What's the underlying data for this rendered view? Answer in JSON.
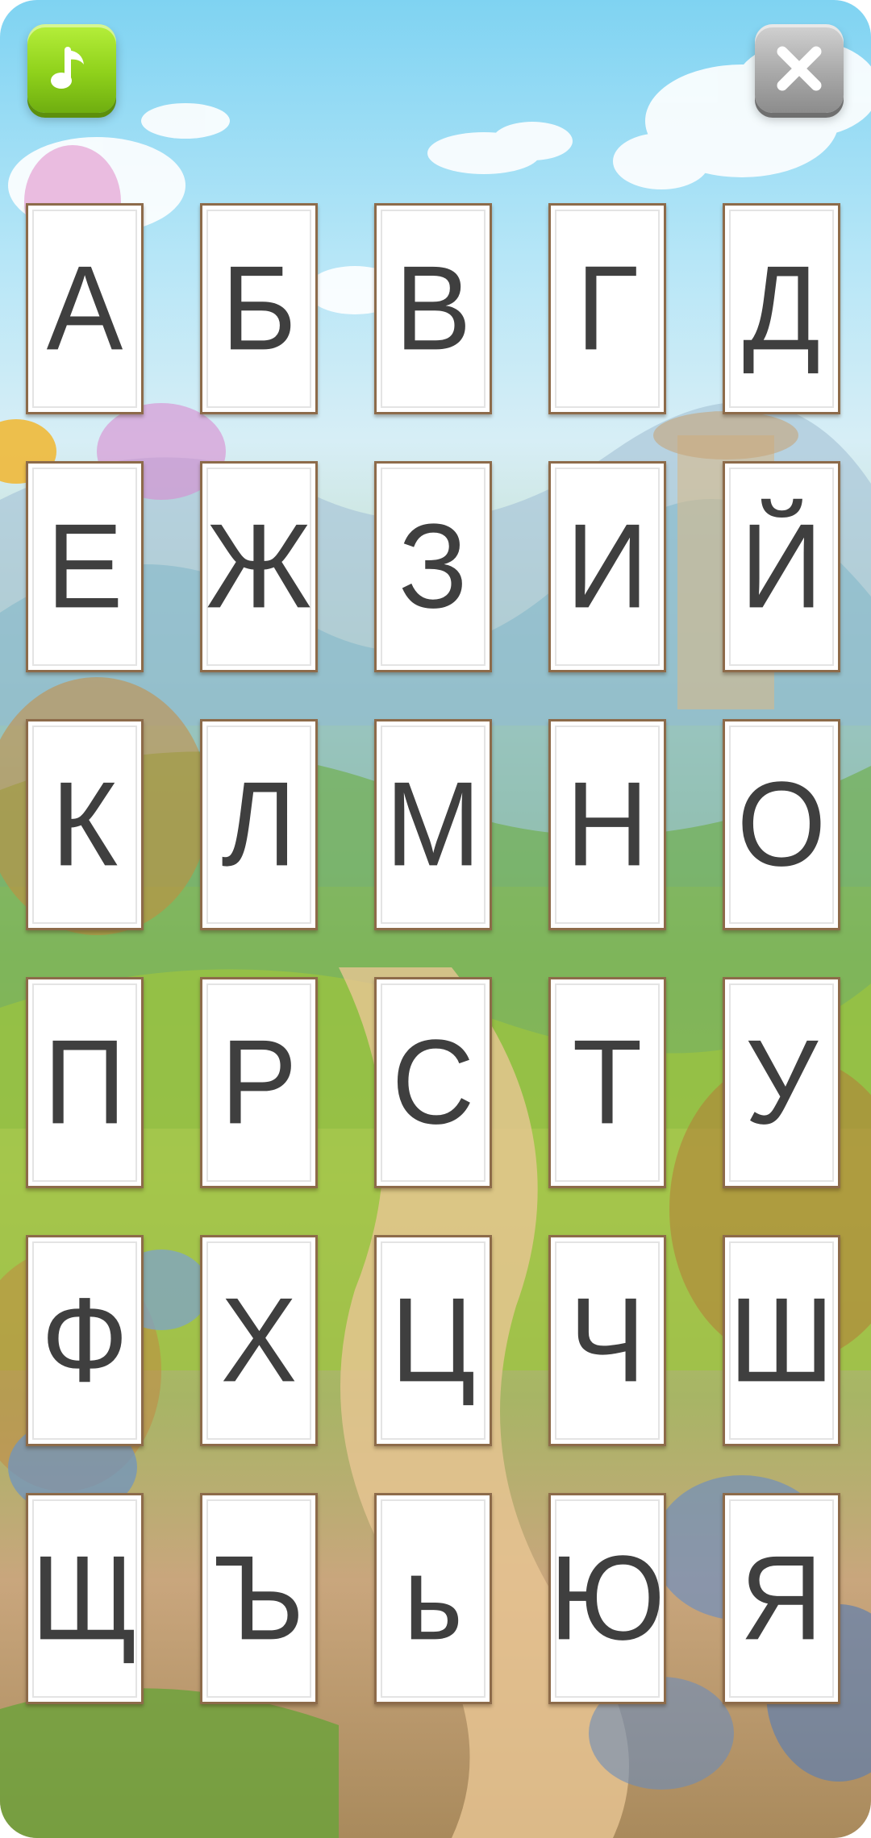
{
  "header": {
    "music_icon": "music-note-icon",
    "close_icon": "close-icon"
  },
  "colors": {
    "card_border": "#8d6b4a",
    "letter": "#3f3f3f",
    "music_button": "#8fd11b",
    "close_button": "#a9a9a9"
  },
  "letters": [
    "А",
    "Б",
    "В",
    "Г",
    "Д",
    "Е",
    "Ж",
    "З",
    "И",
    "Й",
    "К",
    "Л",
    "М",
    "Н",
    "О",
    "П",
    "Р",
    "С",
    "Т",
    "У",
    "Ф",
    "Х",
    "Ц",
    "Ч",
    "Ш",
    "Щ",
    "Ъ",
    "ь",
    "Ю",
    "Я"
  ]
}
